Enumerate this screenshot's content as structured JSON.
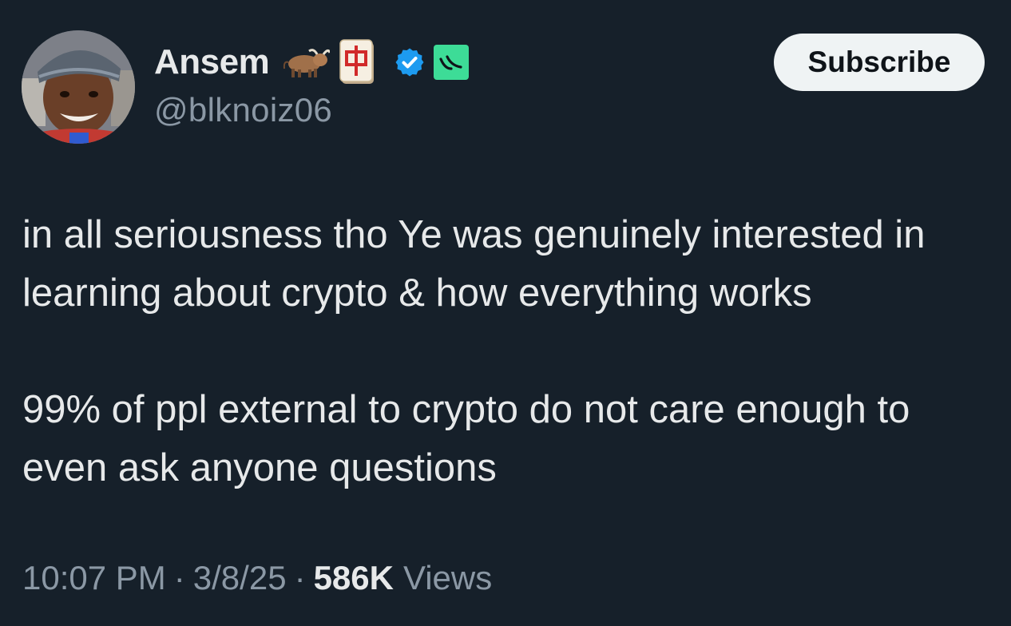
{
  "author": {
    "display_name": "Ansem",
    "handle": "@blknoiz06",
    "badges": [
      "ox-icon",
      "mahjong-red-dragon-icon",
      "verified-check-icon",
      "affiliate-icon"
    ],
    "verified_color": "#1d9bf0",
    "affiliate_color": "#3ddc97"
  },
  "subscribe": {
    "label": "Subscribe"
  },
  "tweet": {
    "paragraphs": [
      "in all seriousness tho Ye was genuinely interested in learning about crypto & how everything works",
      "99% of ppl external to crypto do not care enough to even ask anyone questions"
    ]
  },
  "meta": {
    "time": "10:07 PM",
    "date": "3/8/25",
    "separator": "·",
    "views_count": "586K",
    "views_label": "Views"
  },
  "theme": {
    "background": "#16202a",
    "text": "#e7e9ea",
    "secondary_text": "#8b98a5"
  }
}
